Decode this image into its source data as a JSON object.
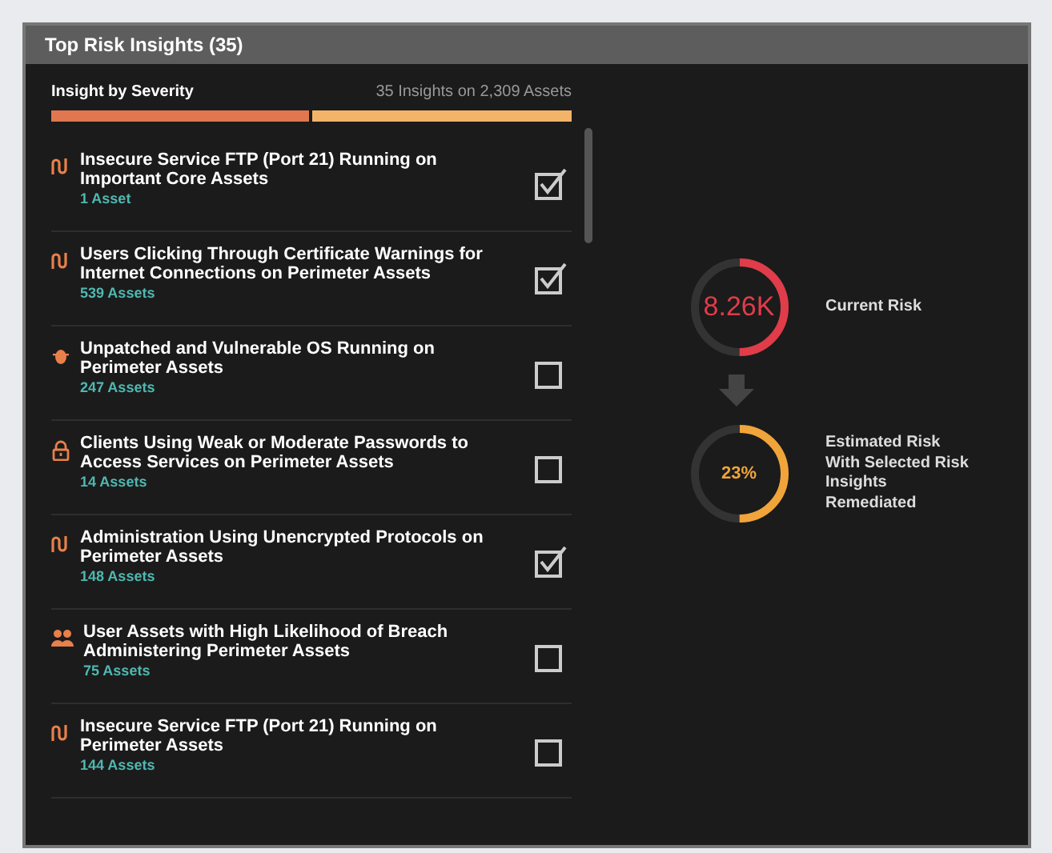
{
  "panel": {
    "title": "Top Risk Insights (35)"
  },
  "severity": {
    "label": "Insight by Severity",
    "summary": "35 Insights on 2,309 Assets",
    "level": 0.5
  },
  "insights": [
    {
      "kind": "flow",
      "title": "Insecure Service FTP (Port 21) Running on Important Core Assets",
      "assets": "1 Asset",
      "checked": true
    },
    {
      "kind": "flow",
      "title": "Users Clicking Through Certificate Warnings for Internet Connections on Perimeter Assets",
      "assets": "539 Assets",
      "checked": true
    },
    {
      "kind": "bug",
      "title": "Unpatched and Vulnerable OS Running on Perimeter Assets",
      "assets": "247 Assets",
      "checked": false
    },
    {
      "kind": "lock",
      "title": "Clients Using Weak or Moderate Passwords to Access Services on Perimeter Assets",
      "assets": "14 Assets",
      "checked": false
    },
    {
      "kind": "flow",
      "title": "Administration Using Unencrypted Protocols on Perimeter Assets",
      "assets": "148 Assets",
      "checked": true
    },
    {
      "kind": "users",
      "title": "User Assets with High Likelihood of Breach Administering Perimeter Assets",
      "assets": "75 Assets",
      "checked": false
    },
    {
      "kind": "flow",
      "title": "Insecure Service FTP (Port 21) Running on Perimeter Assets",
      "assets": "144 Assets",
      "checked": false
    }
  ],
  "gauges": [
    {
      "value": "8.26K",
      "label": "Current Risk",
      "level": 0.5,
      "color": "#e03c4a"
    },
    {
      "value": "23%",
      "label": "Estimated Risk With Selected Risk Insights Remediated",
      "level": 0.5,
      "color": "#f0a43a"
    }
  ]
}
